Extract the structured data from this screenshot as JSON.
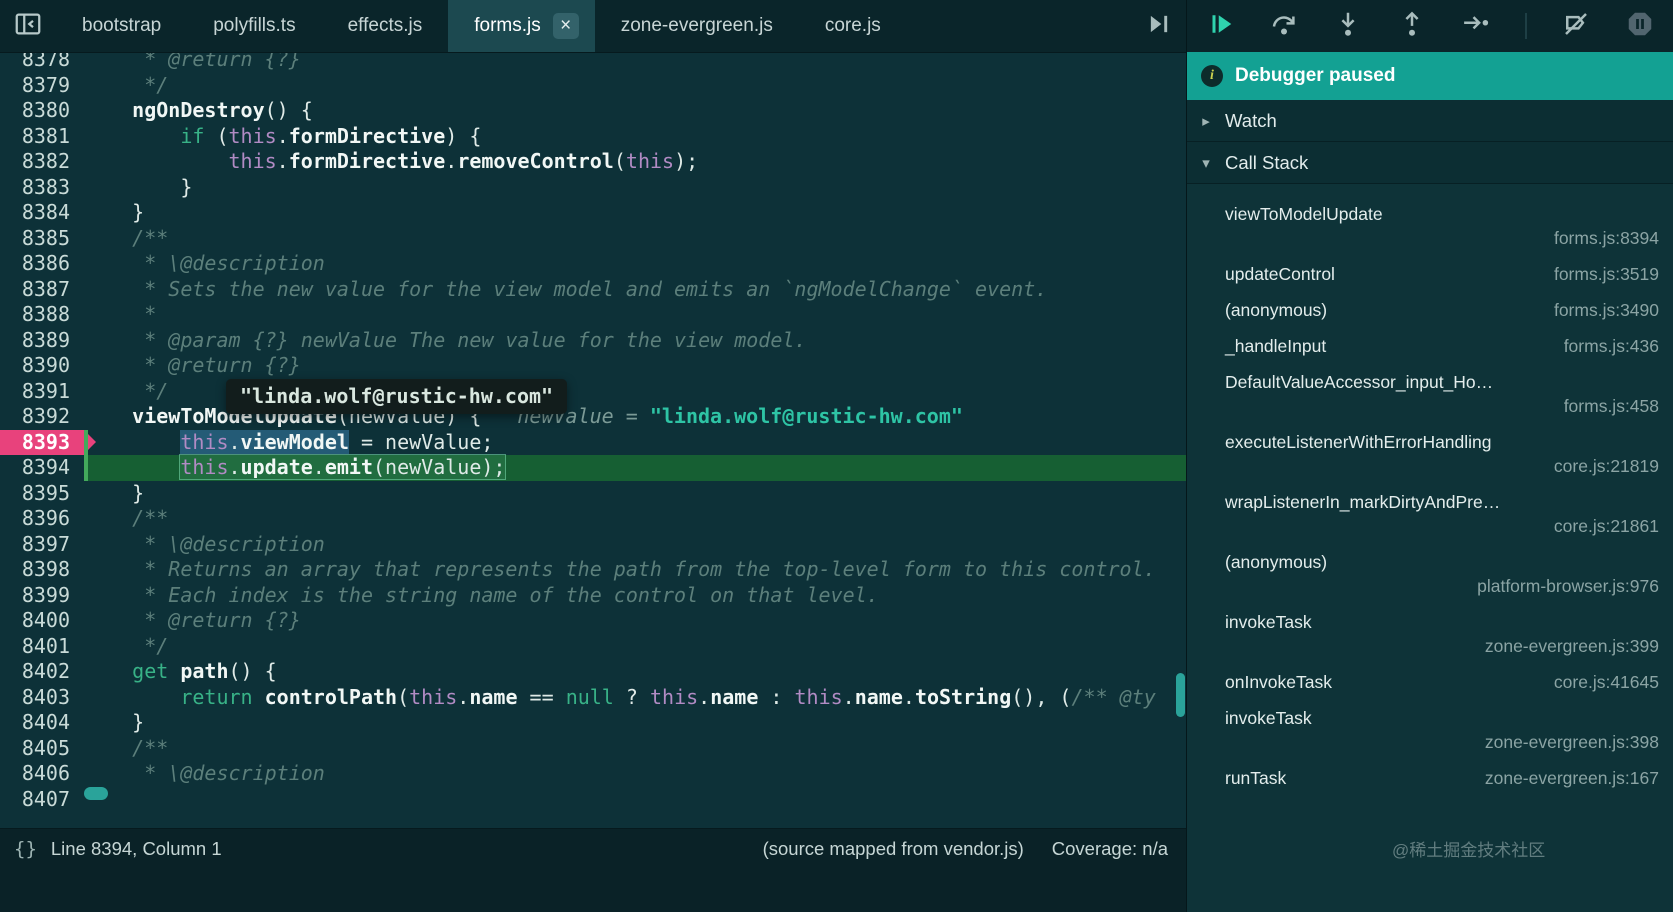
{
  "colors": {
    "accent_teal": "#13a193",
    "exec_line_green": "#1b7630",
    "breakpoint_pink": "#e8427c",
    "string_teal": "#2ec4a5",
    "keyword_green": "#38b287",
    "this_purple": "#b18bc4",
    "comment_gray": "#5c7f7b",
    "selection_blue": "#4696cd",
    "editor_background": "#0d3138"
  },
  "tab_bar": {
    "tabs": [
      {
        "label": "bootstrap",
        "active": false
      },
      {
        "label": "polyfills.ts",
        "active": false
      },
      {
        "label": "effects.js",
        "active": false
      },
      {
        "label": "forms.js",
        "active": true,
        "close_icon": "×"
      },
      {
        "label": "zone-evergreen.js",
        "active": false
      },
      {
        "label": "core.js",
        "active": false
      }
    ]
  },
  "editor": {
    "tooltip_value": "\"linda.wolf@rustic-hw.com\"",
    "breakpoint_line": 8393,
    "execution_line": 8394,
    "lines": [
      {
        "num": 8378,
        "tokens": [
          [
            "c",
            "     * @return {?}"
          ]
        ]
      },
      {
        "num": 8379,
        "tokens": [
          [
            "c",
            "     */"
          ]
        ]
      },
      {
        "num": 8380,
        "tokens": [
          [
            "t",
            "    "
          ],
          [
            "b",
            "ngOnDestroy"
          ],
          [
            "t",
            "() {"
          ]
        ]
      },
      {
        "num": 8381,
        "tokens": [
          [
            "t",
            "        "
          ],
          [
            "k",
            "if"
          ],
          [
            "t",
            " ("
          ],
          [
            "th",
            "this"
          ],
          [
            "t",
            "."
          ],
          [
            "b",
            "formDirective"
          ],
          [
            "t",
            ") {"
          ]
        ]
      },
      {
        "num": 8382,
        "tokens": [
          [
            "t",
            "            "
          ],
          [
            "th",
            "this"
          ],
          [
            "t",
            "."
          ],
          [
            "b",
            "formDirective"
          ],
          [
            "t",
            "."
          ],
          [
            "b",
            "removeControl"
          ],
          [
            "t",
            "("
          ],
          [
            "th",
            "this"
          ],
          [
            "t",
            ");"
          ]
        ]
      },
      {
        "num": 8383,
        "tokens": [
          [
            "t",
            "        }"
          ]
        ]
      },
      {
        "num": 8384,
        "tokens": [
          [
            "t",
            "    }"
          ]
        ]
      },
      {
        "num": 8385,
        "tokens": [
          [
            "c",
            "    /**"
          ]
        ]
      },
      {
        "num": 8386,
        "tokens": [
          [
            "c",
            "     * \\@description"
          ]
        ]
      },
      {
        "num": 8387,
        "tokens": [
          [
            "c",
            "     * Sets the new value for the view model and emits an `ngModelChange` event."
          ]
        ]
      },
      {
        "num": 8388,
        "tokens": [
          [
            "c",
            "     *"
          ]
        ]
      },
      {
        "num": 8389,
        "tokens": [
          [
            "c",
            "     * @param {?} newValue The new value for the view model."
          ]
        ]
      },
      {
        "num": 8390,
        "tokens": [
          [
            "c",
            "     * @return {?}"
          ]
        ]
      },
      {
        "num": 8391,
        "tokens": [
          [
            "c",
            "     */"
          ]
        ]
      },
      {
        "num": 8392,
        "tokens": [
          [
            "t",
            "    "
          ],
          [
            "b",
            "viewToModelUpdate"
          ],
          [
            "t",
            "(newValue) {"
          ]
        ],
        "eval": {
          "label": "newValue = ",
          "value": "\"linda.wolf@rustic-hw.com\""
        }
      },
      {
        "num": 8393,
        "mark": "bp",
        "tokens": [
          [
            "t",
            "        "
          ],
          [
            "th sel",
            "this"
          ],
          [
            "t sel",
            "."
          ],
          [
            "b sel",
            "viewModel"
          ],
          [
            "t",
            " = newValue;"
          ]
        ]
      },
      {
        "num": 8394,
        "mark": "exec",
        "wrap_from": 1,
        "tokens": [
          [
            "t",
            "        "
          ],
          [
            "th",
            "this"
          ],
          [
            "t",
            "."
          ],
          [
            "b",
            "update"
          ],
          [
            "t",
            "."
          ],
          [
            "b",
            "emit"
          ],
          [
            "t",
            "(newValue);"
          ]
        ]
      },
      {
        "num": 8395,
        "tokens": [
          [
            "t",
            "    }"
          ]
        ]
      },
      {
        "num": 8396,
        "tokens": [
          [
            "c",
            "    /**"
          ]
        ]
      },
      {
        "num": 8397,
        "tokens": [
          [
            "c",
            "     * \\@description"
          ]
        ]
      },
      {
        "num": 8398,
        "tokens": [
          [
            "c",
            "     * Returns an array that represents the path from the top-level form to this control."
          ]
        ]
      },
      {
        "num": 8399,
        "tokens": [
          [
            "c",
            "     * Each index is the string name of the control on that level."
          ]
        ]
      },
      {
        "num": 8400,
        "tokens": [
          [
            "c",
            "     * @return {?}"
          ]
        ]
      },
      {
        "num": 8401,
        "tokens": [
          [
            "c",
            "     */"
          ]
        ]
      },
      {
        "num": 8402,
        "tokens": [
          [
            "t",
            "    "
          ],
          [
            "k",
            "get"
          ],
          [
            "t",
            " "
          ],
          [
            "b",
            "path"
          ],
          [
            "t",
            "() {"
          ]
        ]
      },
      {
        "num": 8403,
        "tokens": [
          [
            "t",
            "        "
          ],
          [
            "k",
            "return"
          ],
          [
            "t",
            " "
          ],
          [
            "b",
            "controlPath"
          ],
          [
            "t",
            "("
          ],
          [
            "th",
            "this"
          ],
          [
            "t",
            "."
          ],
          [
            "b",
            "name"
          ],
          [
            "t",
            " == "
          ],
          [
            "k",
            "null"
          ],
          [
            "t",
            " ? "
          ],
          [
            "th",
            "this"
          ],
          [
            "t",
            "."
          ],
          [
            "b",
            "name"
          ],
          [
            "t",
            " : "
          ],
          [
            "th",
            "this"
          ],
          [
            "t",
            "."
          ],
          [
            "b",
            "name"
          ],
          [
            "t",
            "."
          ],
          [
            "b",
            "toString"
          ],
          [
            "t",
            "(), ("
          ],
          [
            "c",
            "/** @ty"
          ]
        ]
      },
      {
        "num": 8404,
        "tokens": [
          [
            "t",
            "    }"
          ]
        ]
      },
      {
        "num": 8405,
        "tokens": [
          [
            "c",
            "    /**"
          ]
        ]
      },
      {
        "num": 8406,
        "tokens": [
          [
            "c",
            "     * \\@description"
          ]
        ]
      },
      {
        "num": 8407,
        "tokens": []
      }
    ]
  },
  "debugger_panel": {
    "toolbar_icons": [
      {
        "name": "resume-script-icon",
        "accent": true
      },
      {
        "name": "step-over-icon"
      },
      {
        "name": "step-into-icon"
      },
      {
        "name": "step-out-icon"
      },
      {
        "name": "step-icon"
      },
      {
        "name": "separator"
      },
      {
        "name": "deactivate-breakpoints-icon"
      },
      {
        "name": "pause-on-exceptions-icon",
        "dark": true
      }
    ],
    "paused_label": "Debugger paused",
    "watch_label": "Watch",
    "call_stack_label": "Call Stack",
    "call_stack": [
      {
        "fn": "viewToModelUpdate",
        "loc": "forms.js:8394",
        "two_line": true
      },
      {
        "fn": "updateControl",
        "loc": "forms.js:3519",
        "two_line": false
      },
      {
        "fn": "(anonymous)",
        "loc": "forms.js:3490",
        "two_line": false
      },
      {
        "fn": "_handleInput",
        "loc": "forms.js:436",
        "two_line": false
      },
      {
        "fn": "DefaultValueAccessor_input_Ho…",
        "loc": "forms.js:458",
        "two_line": true
      },
      {
        "fn": "executeListenerWithErrorHandling",
        "loc": "core.js:21819",
        "two_line": true
      },
      {
        "fn": "wrapListenerIn_markDirtyAndPre…",
        "loc": "core.js:21861",
        "two_line": true
      },
      {
        "fn": "(anonymous)",
        "loc": "platform-browser.js:976",
        "two_line": true
      },
      {
        "fn": "invokeTask",
        "loc": "zone-evergreen.js:399",
        "two_line": true
      },
      {
        "fn": "onInvokeTask",
        "loc": "core.js:41645",
        "two_line": false
      },
      {
        "fn": "invokeTask",
        "loc": "zone-evergreen.js:398",
        "two_line": true
      },
      {
        "fn": "runTask",
        "loc": "zone-evergreen.js:167",
        "two_line": false
      }
    ]
  },
  "status_bar": {
    "position": "Line 8394, Column 1",
    "braces_icon": "{}",
    "source_mapped": "(source mapped from vendor.js)",
    "coverage": "Coverage: n/a"
  },
  "watermark": "@稀土掘金技术社区"
}
